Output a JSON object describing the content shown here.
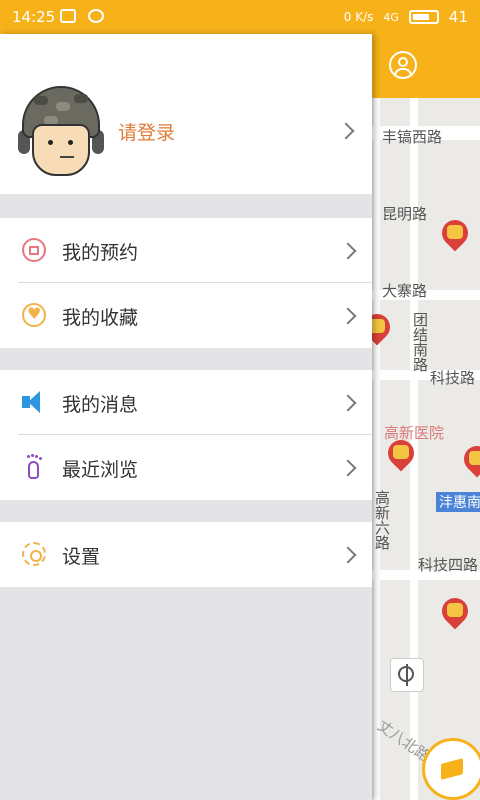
{
  "status_bar": {
    "time": "14:25",
    "net_speed": "0 K/s",
    "signal": "4G",
    "battery": "41"
  },
  "header": {
    "login_label": "请登录"
  },
  "menu": {
    "section1": [
      {
        "label": "我的预约",
        "icon": "calendar-icon"
      },
      {
        "label": "我的收藏",
        "icon": "heart-icon"
      }
    ],
    "section2": [
      {
        "label": "我的消息",
        "icon": "speaker-icon"
      },
      {
        "label": "最近浏览",
        "icon": "footprint-icon"
      }
    ],
    "section3": [
      {
        "label": "设置",
        "icon": "gear-icon"
      }
    ]
  },
  "map": {
    "roads": {
      "r1": "丰镐西路",
      "r2": "昆明路",
      "r3": "大寨路",
      "r4": "团结南路",
      "r5": "科技路",
      "hospital": "高新医院",
      "r6": "沣惠南",
      "r7": "高新六路",
      "r8": "科技四路",
      "r9": "丈八北路"
    }
  },
  "colors": {
    "accent": "#f7b21a",
    "login_text": "#e07b37"
  }
}
